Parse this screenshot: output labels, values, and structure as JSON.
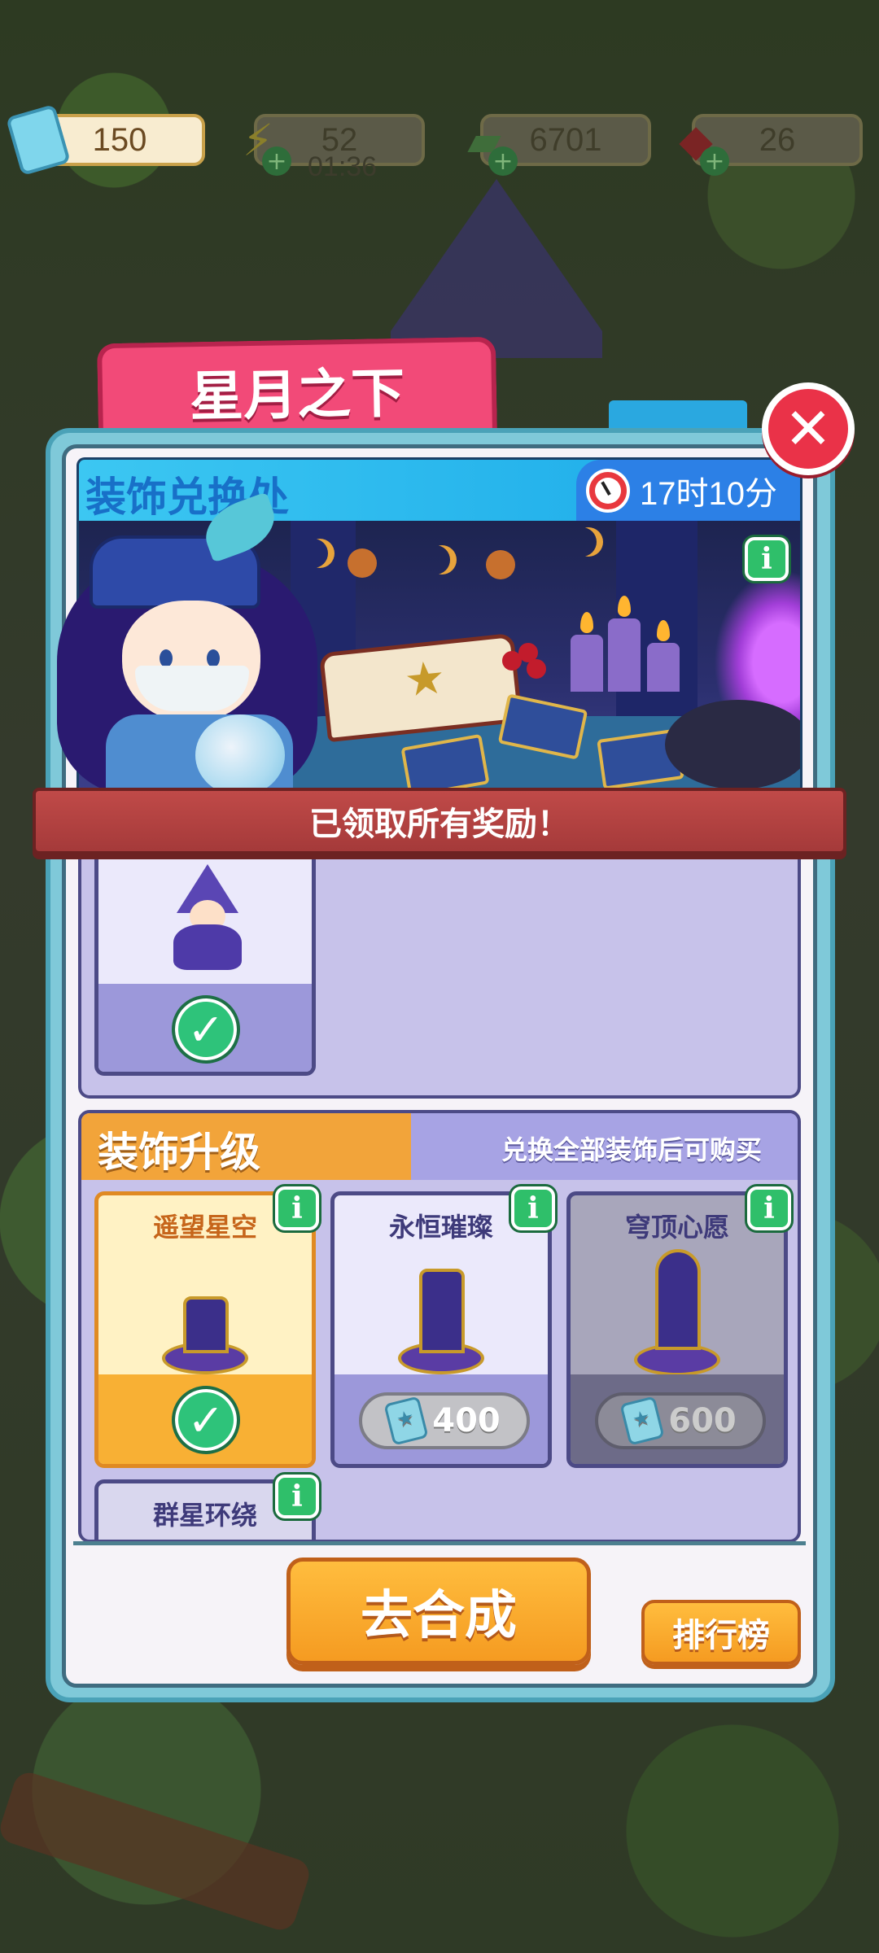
{
  "currency": {
    "tickets": "150",
    "energy": "52",
    "energy_timer": "01:36",
    "coins": "6701",
    "gems": "26"
  },
  "event": {
    "title": "星月之下",
    "shop_title": "装饰兑换处",
    "time_left": "17时10分",
    "status_banner": "已领取所有奖励！"
  },
  "upgrade": {
    "section_title": "装饰升级",
    "hint": "兑换全部装饰后可购买",
    "items": [
      {
        "name": "遥望星空",
        "state": "owned"
      },
      {
        "name": "永恒璀璨",
        "price": "400",
        "state": "available"
      },
      {
        "name": "穹顶心愿",
        "price": "600",
        "state": "locked"
      },
      {
        "name": "群星环绕",
        "state": "partial"
      }
    ]
  },
  "buttons": {
    "go_merge": "去合成",
    "leaderboard": "排行榜"
  },
  "colors": {
    "title_tab": "#f24a78",
    "shop_header": "#1aa9e8",
    "ribbon": "#b04040",
    "orange_button": "#f59b21",
    "check_green": "#2ec37a"
  }
}
